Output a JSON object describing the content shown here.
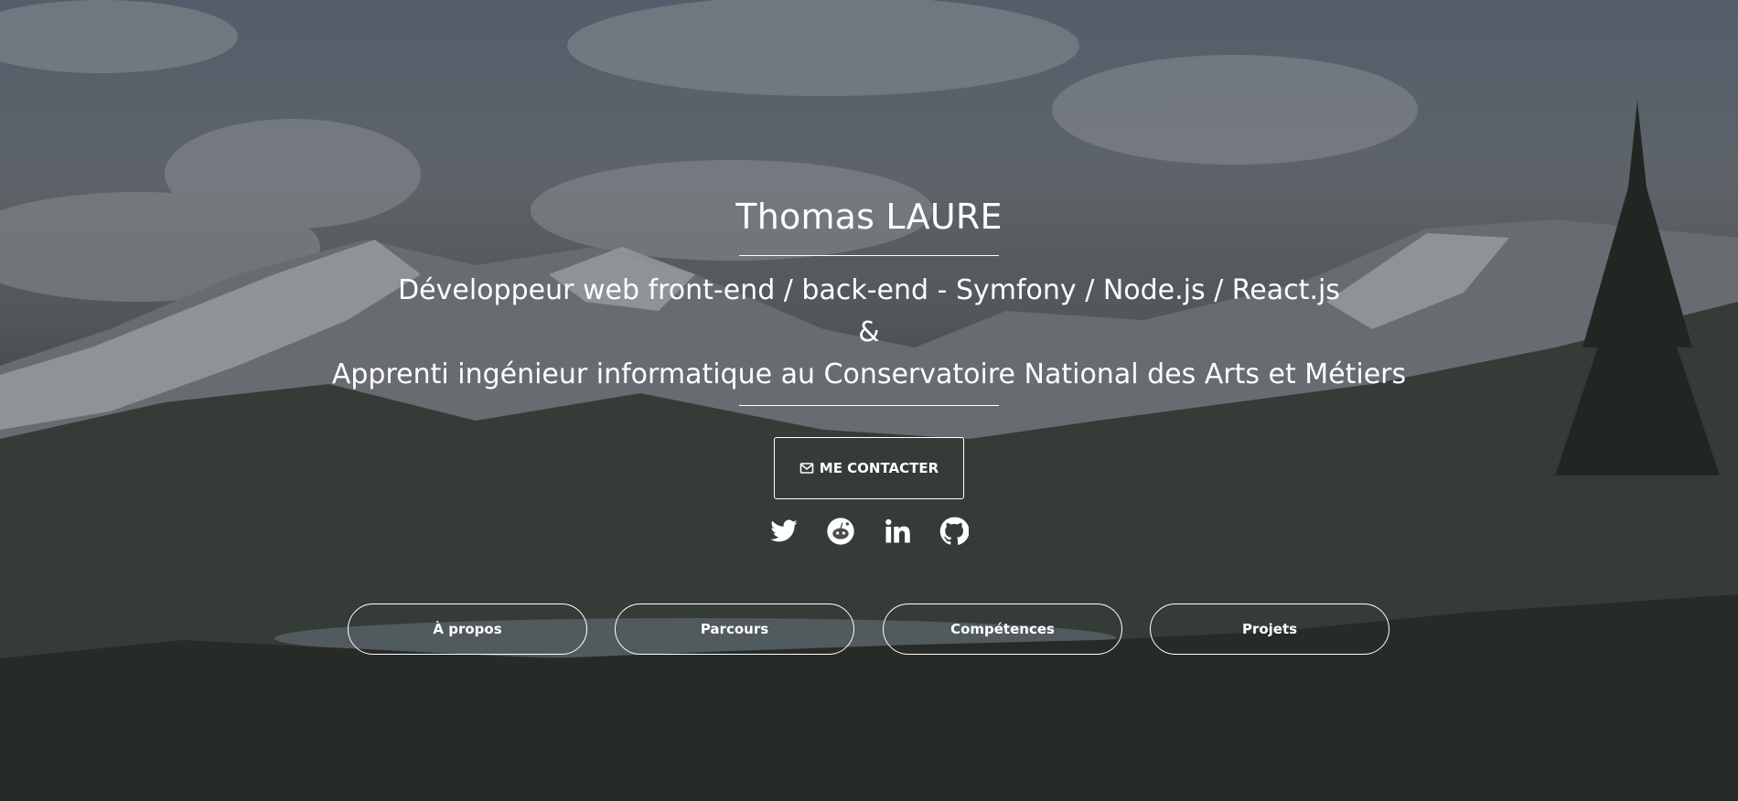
{
  "hero": {
    "name": "Thomas LAURE",
    "subtitle_line1": "Développeur web front-end / back-end - Symfony / Node.js / React.js",
    "subtitle_line2": "&",
    "subtitle_line3": "Apprenti ingénieur informatique au Conservatoire National des Arts et Métiers",
    "contact_label": "ME CONTACTER",
    "contact_icon": "envelope-icon"
  },
  "socials": [
    {
      "name": "twitter-icon"
    },
    {
      "name": "reddit-icon"
    },
    {
      "name": "linkedin-icon"
    },
    {
      "name": "github-icon"
    }
  ],
  "nav": [
    {
      "label": "À propos"
    },
    {
      "label": "Parcours"
    },
    {
      "label": "Compétences"
    },
    {
      "label": "Projets"
    }
  ],
  "colors": {
    "text": "#ffffff",
    "overlay": "#2a2c2e"
  }
}
